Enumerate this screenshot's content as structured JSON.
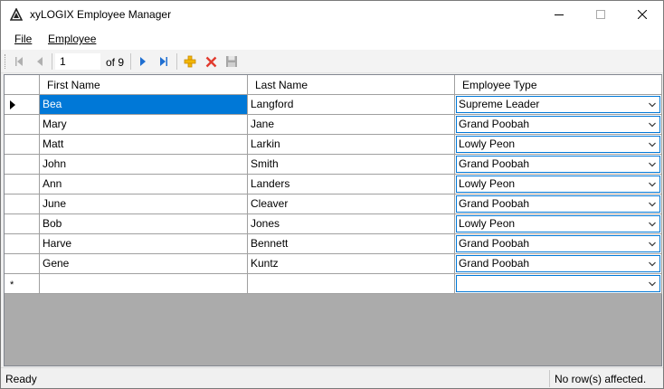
{
  "window": {
    "title": "xyLOGIX Employee Manager"
  },
  "menu": {
    "items": [
      {
        "label": "File"
      },
      {
        "label": "Employee"
      }
    ]
  },
  "navigator": {
    "position": "1",
    "count_label": "of 9"
  },
  "grid": {
    "columns": [
      "First Name",
      "Last Name",
      "Employee Type"
    ],
    "rows": [
      {
        "first": "Bea",
        "last": "Langford",
        "type": "Supreme Leader"
      },
      {
        "first": "Mary",
        "last": "Jane",
        "type": "Grand Poobah"
      },
      {
        "first": "Matt",
        "last": "Larkin",
        "type": "Lowly Peon"
      },
      {
        "first": "John",
        "last": "Smith",
        "type": "Grand Poobah"
      },
      {
        "first": "Ann",
        "last": "Landers",
        "type": "Lowly Peon"
      },
      {
        "first": "June",
        "last": "Cleaver",
        "type": "Grand Poobah"
      },
      {
        "first": "Bob",
        "last": "Jones",
        "type": "Lowly Peon"
      },
      {
        "first": "Harve",
        "last": "Bennett",
        "type": "Grand Poobah"
      },
      {
        "first": "Gene",
        "last": "Kuntz",
        "type": "Grand Poobah"
      }
    ],
    "new_row_marker": "*",
    "selection_color": "#0078d7"
  },
  "status": {
    "left": "Ready",
    "right": "No row(s) affected."
  },
  "icons": {
    "app": "app-logo-icon",
    "minimize": "minimize-icon",
    "maximize": "maximize-icon",
    "close": "close-icon",
    "move_first": "move-first-icon",
    "move_previous": "move-previous-icon",
    "move_next": "move-next-icon",
    "move_last": "move-last-icon",
    "add_new": "add-new-icon",
    "delete": "delete-icon",
    "save": "save-icon"
  }
}
